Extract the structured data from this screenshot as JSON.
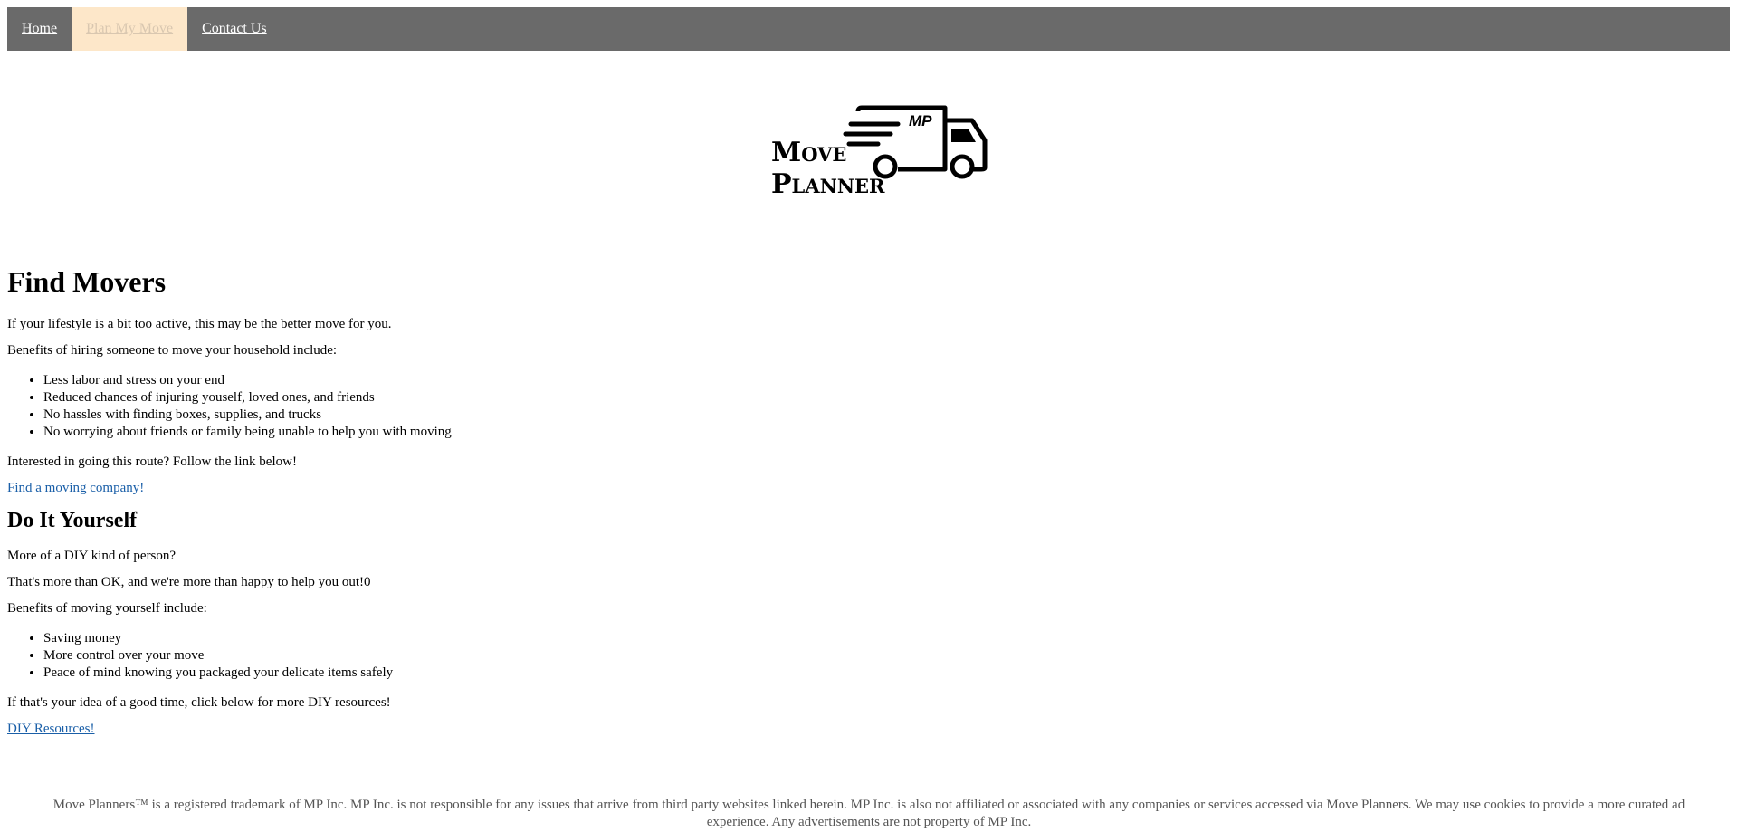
{
  "nav": {
    "items": [
      {
        "label": "Home"
      },
      {
        "label": "Plan My Move"
      },
      {
        "label": "Contact Us"
      }
    ]
  },
  "logo": {
    "line1": "Move",
    "line2": "Planner",
    "truck_text": "MP"
  },
  "movers": {
    "heading": "Find Movers",
    "intro": "If your lifestyle is a bit too active, this may be the better move for you.",
    "benefits_intro": "Benefits of hiring someone to move your household include:",
    "benefits": [
      "Less labor and stress on your end",
      "Reduced chances of injuring youself, loved ones, and friends",
      "No hassles with finding boxes, supplies, and trucks",
      "No worrying about friends or family being unable to help you with moving"
    ],
    "cta_text": "Interested in going this route? Follow the link below!",
    "link": "Find a moving company!"
  },
  "diy": {
    "heading": "Do It Yourself",
    "question": "More of a DIY kind of person?",
    "reassure": "That's more than OK, and we're more than happy to help you out!0",
    "benefits_intro": "Benefits of moving yourself include:",
    "benefits": [
      "Saving money",
      "More control over your move",
      "Peace of mind knowing you packaged your delicate items safely"
    ],
    "cta_text": "If that's your idea of a good time, click below for more DIY resources!",
    "link": "DIY Resources!"
  },
  "footer": {
    "text": "Move Planners™ is a registered trademark of MP Inc. MP Inc. is not responsible for any issues that arrive from third party websites linked herein. MP Inc. is also not affiliated or associated with any companies or services accessed via Move Planners. We may use cookies to provide a more curated ad experience. Any advertisements are not property of MP Inc."
  }
}
